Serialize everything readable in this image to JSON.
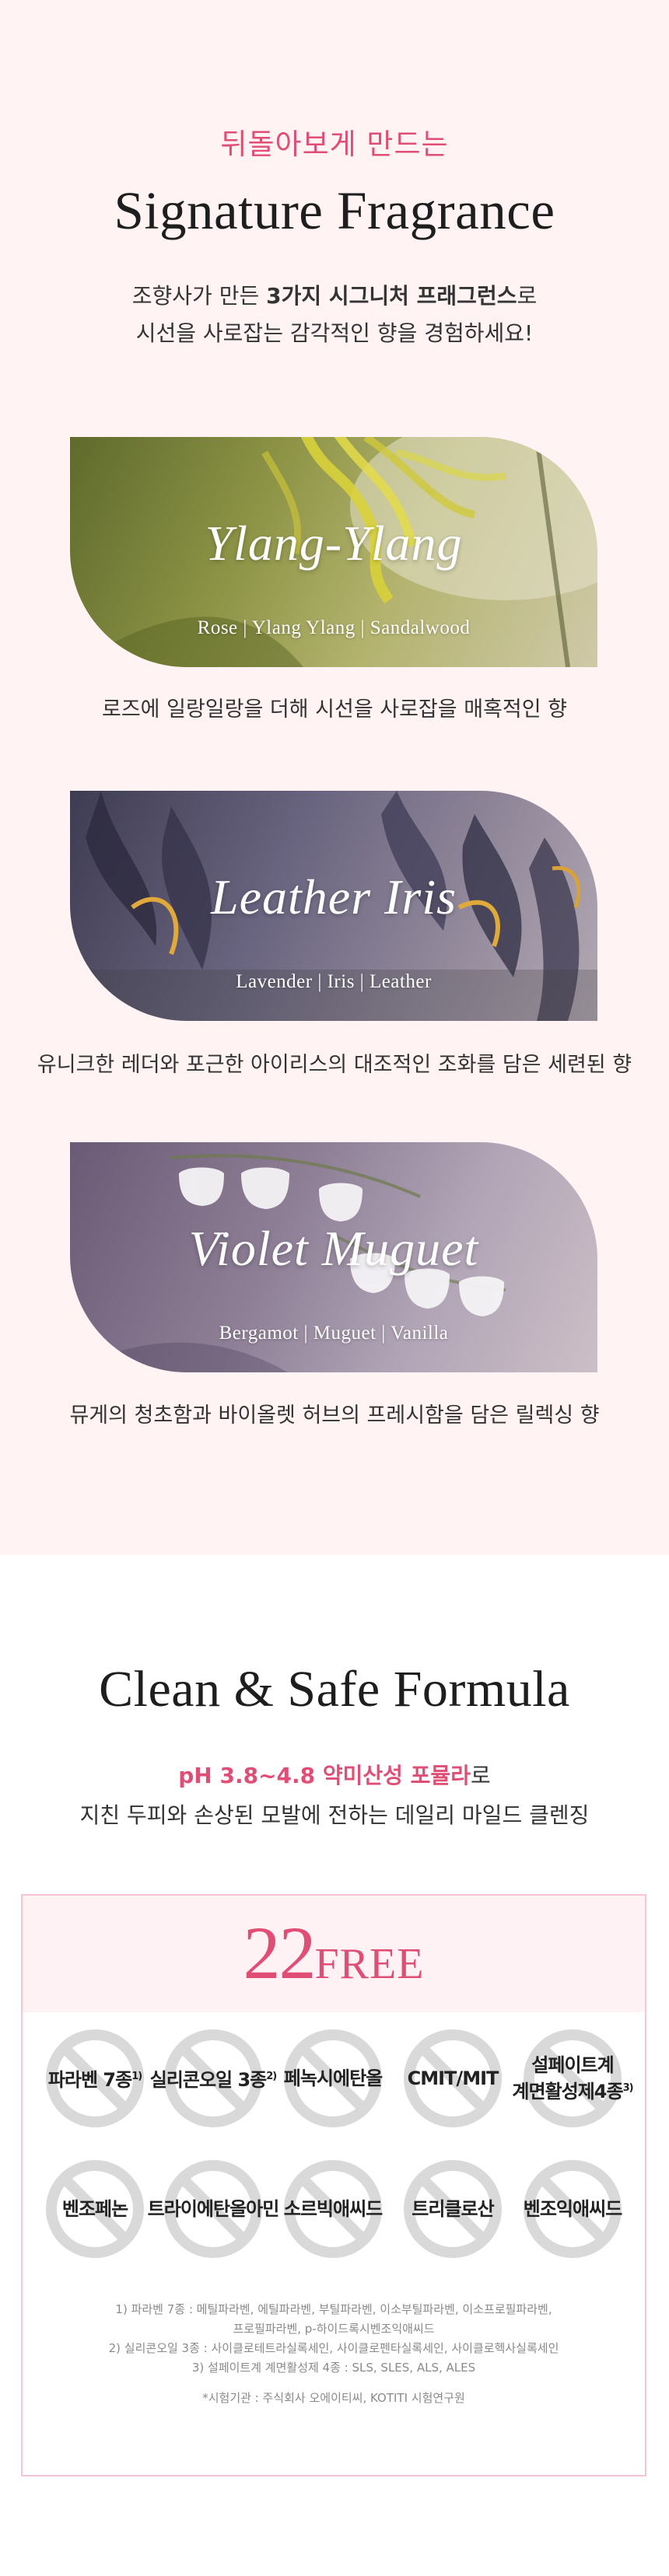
{
  "signature": {
    "kicker": "뒤돌아보게 만드는",
    "title": "Signature Fragrance",
    "desc_line1_pre": "조향사가 만든 ",
    "desc_line1_bold": "3가지 시그니처 프래그런스",
    "desc_line1_post": "로",
    "desc_line2": "시선을 사로잡는 감각적인 향을 경험하세요!",
    "fragrances": [
      {
        "name": "Ylang-Ylang",
        "notes": "Rose | Ylang Ylang | Sandalwood",
        "desc": "로즈에 일랑일랑을 더해 시선을 사로잡을 매혹적인 향"
      },
      {
        "name": "Leather Iris",
        "notes": "Lavender  |  Iris  |  Leather",
        "desc": "유니크한 레더와 포근한 아이리스의 대조적인 조화를 담은 세련된 향"
      },
      {
        "name": "Violet Muguet",
        "notes": "Bergamot |  Muguet  |  Vanilla",
        "desc": "뮤게의 청초함과 바이올렛 허브의 프레시함을 담은 릴렉싱 향"
      }
    ]
  },
  "formula": {
    "title": "Clean & Safe Formula",
    "sub1_highlight": "pH 3.8~4.8 약미산성 포뮬라",
    "sub1_post": "로",
    "sub2": "지친 두피와 손상된 모발에 전하는 데일리 마일드 클렌징",
    "free_number": "22",
    "free_word": "FREE",
    "badges": [
      {
        "label": "파라벤 7종",
        "sup": "1)"
      },
      {
        "label": "실리콘오일 3종",
        "sup": "2)"
      },
      {
        "label": "페녹시에탄올",
        "sup": ""
      },
      {
        "label": "CMIT/MIT",
        "sup": ""
      },
      {
        "label_line1": "설페이트계",
        "label_line2": "계면활성제4종",
        "sup": "3)"
      },
      {
        "label": "벤조페논",
        "sup": ""
      },
      {
        "label": "트라이에탄올아민",
        "sup": ""
      },
      {
        "label": "소르빅애씨드",
        "sup": ""
      },
      {
        "label": "트리클로산",
        "sup": ""
      },
      {
        "label": "벤조익애씨드",
        "sup": ""
      }
    ],
    "notes": [
      "1) 파라벤 7종 : 메틸파라벤, 에틸파라벤, 부틸파라벤, 이소부틸파라벤, 이소프로필파라벤,",
      "프로필파라벤, p-하이드록시벤조익애씨드",
      "2) 실리콘오일 3종 : 사이클로테트라실록세인, 사이클로펜타실록세인, 사이클로헥사실록세인",
      "3) 설페이트계 계면활성제 4종 : SLS, SLES, ALS, ALES"
    ],
    "source": "*시험기관 : 주식회사 오에이티씨, KOTITI 시험연구원"
  }
}
